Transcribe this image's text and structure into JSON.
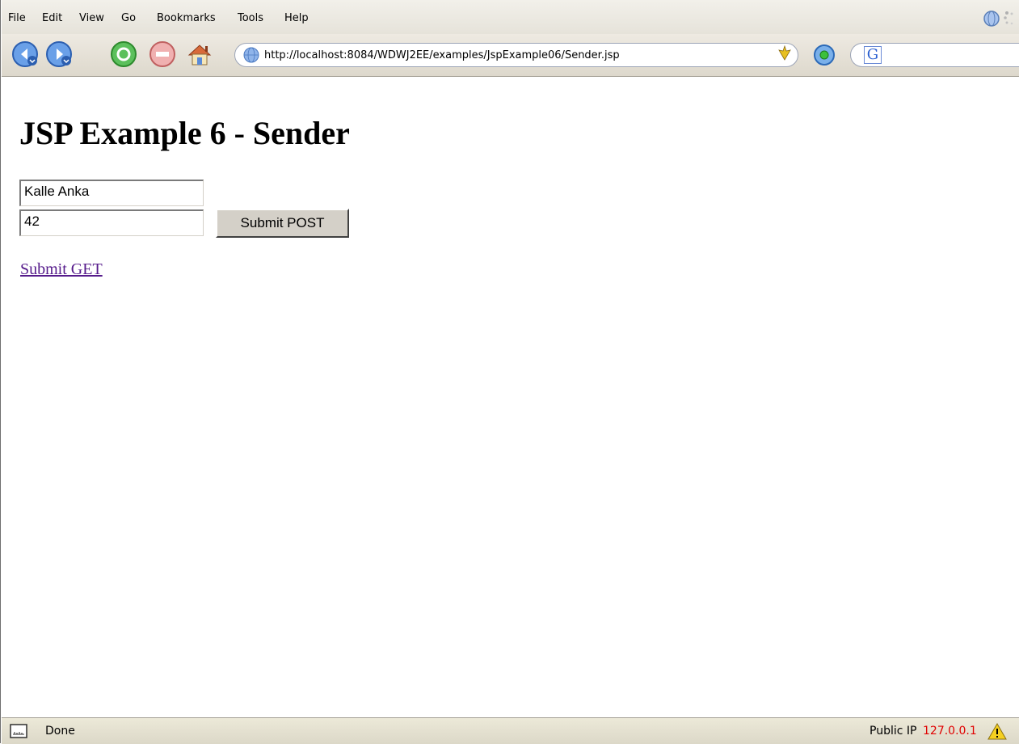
{
  "menu": {
    "items": [
      {
        "label": "File",
        "icon": "",
        "accent": ""
      },
      {
        "label": "Edit"
      },
      {
        "label": "View"
      },
      {
        "label": "Go"
      },
      {
        "label": "Bookmarks"
      },
      {
        "label": "Tools"
      },
      {
        "label": "Help"
      }
    ]
  },
  "toolbar": {
    "back_icon": "back-arrow-icon",
    "forward_icon": "forward-arrow-icon",
    "reload_icon": "reload-icon",
    "stop_icon": "stop-icon",
    "home_icon": "home-icon",
    "url": "http://localhost:8084/WDWJ2EE/examples/JspExample06/Sender.jsp",
    "search_engine": "G"
  },
  "page": {
    "title": "JSP Example 6 - Sender",
    "name_value": "Kalle Anka",
    "age_value": "42",
    "submit_post_label": "Submit POST",
    "submit_get_label": "Submit GET"
  },
  "status": {
    "text": "Done",
    "public_ip_label": "Public IP",
    "public_ip_value": "127.0.0.1",
    "ip_color": "#e00000"
  },
  "colors": {
    "link_visited": "#551a8b",
    "nav_blue": "#3a7bd5"
  }
}
